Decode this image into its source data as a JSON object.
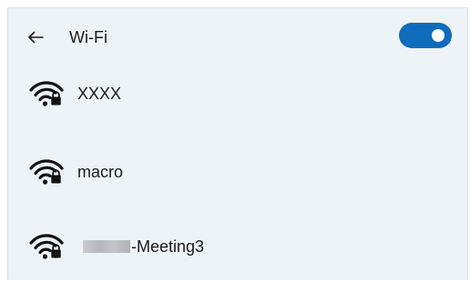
{
  "header": {
    "title": "Wi-Fi",
    "wifi_enabled": true
  },
  "colors": {
    "accent": "#0f6cbd",
    "background": "#eef3f8"
  },
  "networks": [
    {
      "name": "XXXX",
      "secured": true,
      "icon": "wifi-lock-icon"
    },
    {
      "name": "macro",
      "secured": true,
      "icon": "wifi-lock-icon"
    },
    {
      "name": "-Meeting3",
      "name_prefix_redacted": true,
      "secured": true,
      "icon": "wifi-lock-icon"
    }
  ]
}
